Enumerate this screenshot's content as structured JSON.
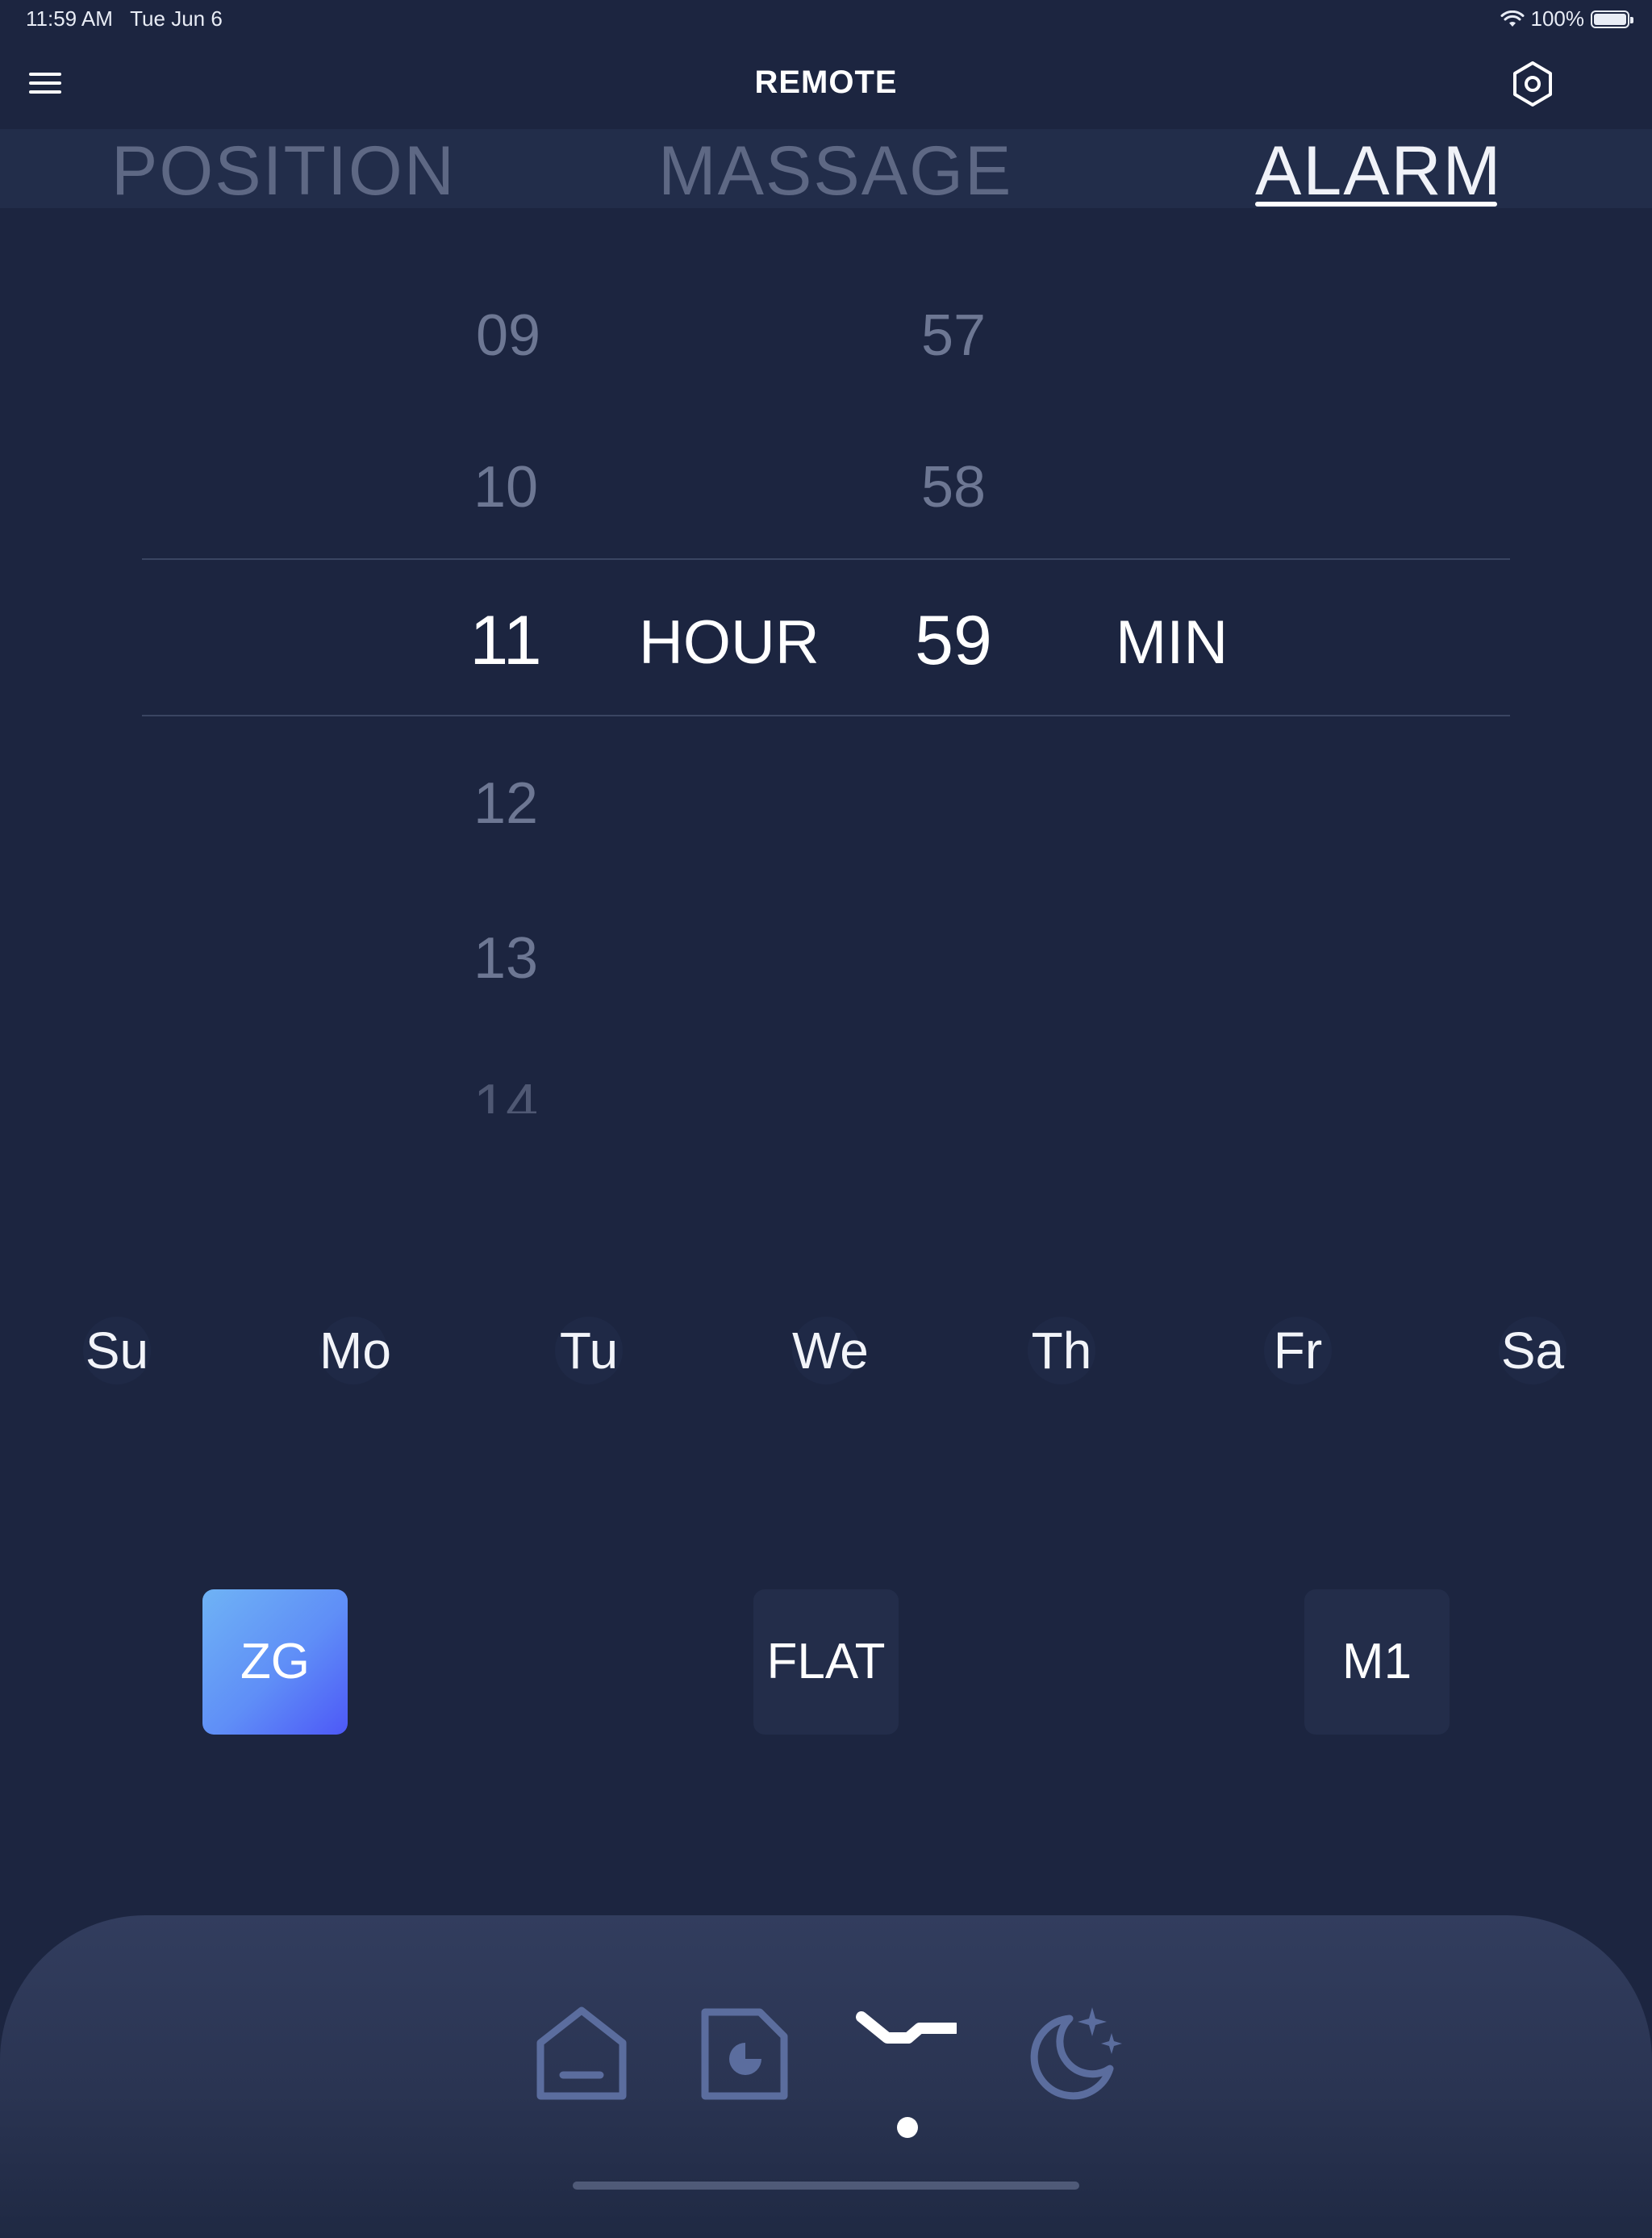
{
  "status_bar": {
    "time": "11:59 AM",
    "date": "Tue Jun 6",
    "battery": "100%",
    "battery_level": 1.0
  },
  "header": {
    "title": "REMOTE",
    "menu_icon": "hamburger-icon",
    "settings_icon": "hexagon-settings-icon"
  },
  "tabs": [
    {
      "label": "POSITION",
      "active": false
    },
    {
      "label": "MASSAGE",
      "active": false
    },
    {
      "label": "ALARM",
      "active": true
    }
  ],
  "picker": {
    "hours": [
      "09",
      "10",
      "11",
      "12",
      "13",
      "14"
    ],
    "selected_hour": "11",
    "hour_unit": "HOUR",
    "minutes": [
      "57",
      "58",
      "59"
    ],
    "selected_minute": "59",
    "minute_unit": "MIN"
  },
  "days": [
    "Su",
    "Mo",
    "Tu",
    "We",
    "Th",
    "Fr",
    "Sa"
  ],
  "presets": [
    {
      "label": "ZG",
      "active": true
    },
    {
      "label": "FLAT",
      "active": false
    },
    {
      "label": "M1",
      "active": false
    }
  ],
  "bottom_nav": [
    {
      "icon": "home-icon",
      "active": false
    },
    {
      "icon": "report-icon",
      "active": false
    },
    {
      "icon": "bed-remote-icon",
      "active": true
    },
    {
      "icon": "sleep-moon-icon",
      "active": false
    }
  ],
  "colors": {
    "background": "#1c2540",
    "accent_start": "#6fb3f5",
    "accent_end": "#4d58f7"
  }
}
